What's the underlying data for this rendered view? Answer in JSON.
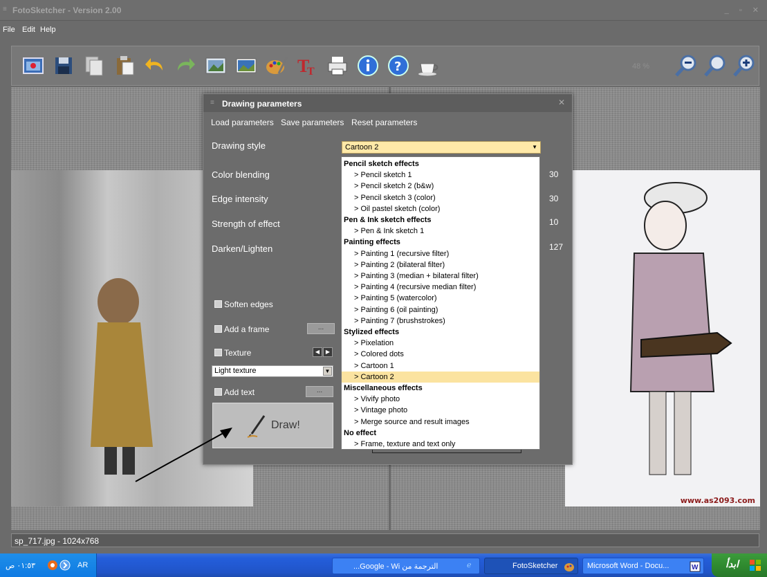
{
  "window": {
    "title": "FotoSketcher - Version 2.00",
    "controls": "_ ▫ ✕"
  },
  "menu": [
    "File",
    "Edit",
    "Help"
  ],
  "toolbar": {
    "zoom": "48 %",
    "icons": [
      "open-image-icon",
      "save-icon",
      "copy-icon",
      "paste-icon",
      "undo-icon",
      "redo-icon",
      "source-image-icon",
      "result-image-icon",
      "drawing-parameters-icon",
      "text-icon",
      "print-icon",
      "info-icon",
      "help-icon",
      "coffee-icon",
      "zoom-out-icon",
      "zoom-100-icon",
      "zoom-in-icon"
    ]
  },
  "dialog": {
    "title": "Drawing parameters",
    "close": "✕",
    "links": [
      "Load parameters",
      "Save parameters",
      "Reset parameters"
    ],
    "params": [
      {
        "label": "Drawing style",
        "value": ""
      },
      {
        "label": "Color blending",
        "value": "30"
      },
      {
        "label": "Edge intensity",
        "value": "30"
      },
      {
        "label": "Strength of effect",
        "value": "10"
      },
      {
        "label": "Darken/Lighten",
        "value": "127"
      }
    ],
    "style_selected": "Cartoon 2",
    "soften_edges": "Soften edges",
    "add_frame": "Add a frame",
    "texture": "Texture",
    "texture_value": "Light texture",
    "add_text": "Add text",
    "ellipsis": "...",
    "draw": "Draw!"
  },
  "dropdown": [
    {
      "type": "group",
      "text": "Pencil sketch effects"
    },
    {
      "type": "item",
      "text": "> Pencil sketch 1"
    },
    {
      "type": "item",
      "text": "> Pencil sketch 2 (b&w)"
    },
    {
      "type": "item",
      "text": "> Pencil sketch 3 (color)"
    },
    {
      "type": "item",
      "text": "> Oil pastel sketch (color)"
    },
    {
      "type": "group",
      "text": "Pen & Ink sketch effects"
    },
    {
      "type": "item",
      "text": "> Pen & Ink sketch 1"
    },
    {
      "type": "group",
      "text": "Painting effects"
    },
    {
      "type": "item",
      "text": "> Painting 1 (recursive filter)"
    },
    {
      "type": "item",
      "text": "> Painting 2 (bilateral filter)"
    },
    {
      "type": "item",
      "text": "> Painting 3 (median + bilateral filter)"
    },
    {
      "type": "item",
      "text": "> Painting 4 (recursive median filter)"
    },
    {
      "type": "item",
      "text": "> Painting 5 (watercolor)"
    },
    {
      "type": "item",
      "text": "> Painting 6 (oil painting)"
    },
    {
      "type": "item",
      "text": "> Painting 7 (brushstrokes)"
    },
    {
      "type": "group",
      "text": "Stylized effects"
    },
    {
      "type": "item",
      "text": "> Pixelation"
    },
    {
      "type": "item",
      "text": "> Colored dots"
    },
    {
      "type": "item",
      "text": "> Cartoon 1"
    },
    {
      "type": "item",
      "text": "> Cartoon 2",
      "selected": true
    },
    {
      "type": "group",
      "text": "Miscellaneous effects"
    },
    {
      "type": "item",
      "text": "> Vivify photo"
    },
    {
      "type": "item",
      "text": "> Vintage photo"
    },
    {
      "type": "item",
      "text": "> Merge source and result images"
    },
    {
      "type": "group",
      "text": "No effect"
    },
    {
      "type": "item",
      "text": "> Frame, texture and text only"
    }
  ],
  "canvas": {
    "watermark": "www.as2093.com"
  },
  "status": "sp_717.jpg - 1024x768",
  "taskbar": {
    "clock": "٠١:٥٣ ص",
    "lang": "AR",
    "tasks": [
      {
        "label": "...Google - Wi الترجمة من",
        "active": false
      },
      {
        "label": "FotoSketcher",
        "active": true
      },
      {
        "label": "Microsoft Word - Docu...",
        "active": false
      }
    ],
    "start": "ابدأ"
  }
}
